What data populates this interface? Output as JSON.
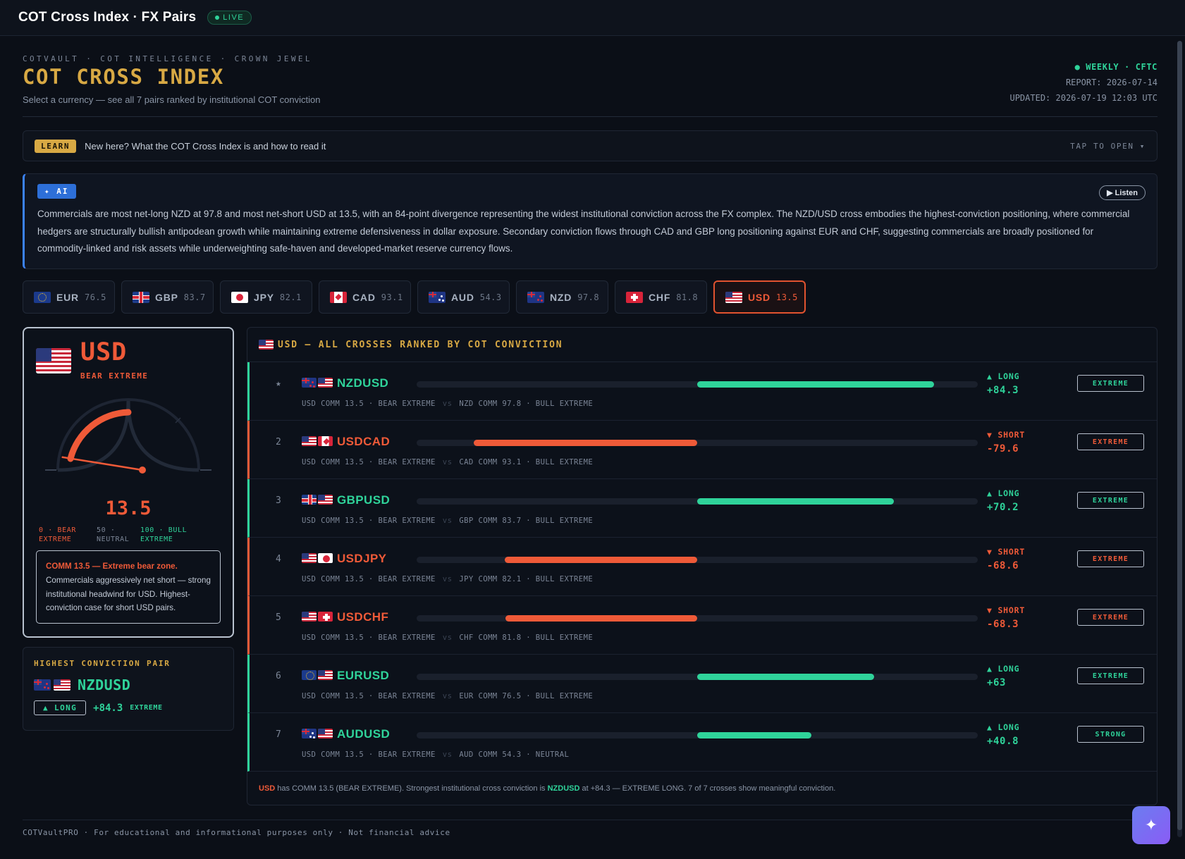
{
  "topbar": {
    "title": "COT Cross Index · FX Pairs",
    "live_label": "LIVE"
  },
  "header": {
    "eyebrow": "COTVAULT · COT INTELLIGENCE · CROWN JEWEL",
    "title": "COT CROSS INDEX",
    "subtitle": "Select a currency — see all 7 pairs ranked by institutional COT conviction",
    "weekly": "● WEEKLY · CFTC",
    "report": "REPORT: 2026-07-14",
    "updated": "UPDATED: 2026-07-19 12:03 UTC"
  },
  "learn": {
    "badge": "LEARN",
    "text": "New here? What the COT Cross Index is and how to read it",
    "tap": "TAP TO OPEN ▾"
  },
  "ai": {
    "badge": "✦ AI",
    "listen": "▶ Listen",
    "text": "Commercials are most net-long NZD at 97.8 and most net-short USD at 13.5, with an 84-point divergence representing the widest institutional conviction across the FX complex. The NZD/USD cross embodies the highest-conviction positioning, where commercial hedgers are structurally bullish antipodean growth while maintaining extreme defensiveness in dollar exposure. Secondary conviction flows through CAD and GBP long positioning against EUR and CHF, suggesting commercials are broadly positioned for commodity-linked and risk assets while underweighting safe-haven and developed-market reserve currency flows."
  },
  "tabs": [
    {
      "code": "EUR",
      "score": "76.5",
      "flag": "f-eur"
    },
    {
      "code": "GBP",
      "score": "83.7",
      "flag": "f-gbp"
    },
    {
      "code": "JPY",
      "score": "82.1",
      "flag": "f-jpy"
    },
    {
      "code": "CAD",
      "score": "93.1",
      "flag": "f-cad"
    },
    {
      "code": "AUD",
      "score": "54.3",
      "flag": "f-aud"
    },
    {
      "code": "NZD",
      "score": "97.8",
      "flag": "f-nzd"
    },
    {
      "code": "CHF",
      "score": "81.8",
      "flag": "f-chf"
    },
    {
      "code": "USD",
      "score": "13.5",
      "flag": "f-usd",
      "active": true
    }
  ],
  "gauge": {
    "currency": "USD",
    "zone": "BEAR EXTREME",
    "value": "13.5",
    "value_num": 13.5,
    "scale_bear": "0 · BEAR EXTREME",
    "scale_bear_a": "0 · BEAR",
    "scale_bear_b": "EXTREME",
    "scale_neutral_a": "50 ·",
    "scale_neutral_b": "NEUTRAL",
    "scale_bull_a": "100 · BULL",
    "scale_bull_b": "EXTREME",
    "note_bold": "COMM 13.5 — Extreme bear zone.",
    "note_rest": " Commercials aggressively net short — strong institutional headwind for USD. Highest-conviction case for short USD pairs."
  },
  "highest": {
    "label": "HIGHEST CONVICTION PAIR",
    "pair": "NZDUSD",
    "direction": "▲ LONG",
    "change": "+84.3",
    "strength": "EXTREME"
  },
  "ranking": {
    "title": "USD — ALL CROSSES RANKED BY COT CONVICTION",
    "rows": [
      {
        "rank": "★",
        "pair": "NZDUSD",
        "flags": [
          "f-nzd",
          "f-usd"
        ],
        "dir": "▲ LONG",
        "change": "+84.3",
        "value": 84.3,
        "tag": "EXTREME",
        "left": "USD COMM 13.5 · BEAR EXTREME",
        "vs": "vs",
        "right": "NZD COMM 97.8 · BULL EXTREME"
      },
      {
        "rank": "2",
        "pair": "USDCAD",
        "flags": [
          "f-usd",
          "f-cad"
        ],
        "dir": "▼ SHORT",
        "change": "-79.6",
        "value": -79.6,
        "tag": "EXTREME",
        "left": "USD COMM 13.5 · BEAR EXTREME",
        "vs": "vs",
        "right": "CAD COMM 93.1 · BULL EXTREME"
      },
      {
        "rank": "3",
        "pair": "GBPUSD",
        "flags": [
          "f-gbp",
          "f-usd"
        ],
        "dir": "▲ LONG",
        "change": "+70.2",
        "value": 70.2,
        "tag": "EXTREME",
        "left": "USD COMM 13.5 · BEAR EXTREME",
        "vs": "vs",
        "right": "GBP COMM 83.7 · BULL EXTREME"
      },
      {
        "rank": "4",
        "pair": "USDJPY",
        "flags": [
          "f-usd",
          "f-jpy"
        ],
        "dir": "▼ SHORT",
        "change": "-68.6",
        "value": -68.6,
        "tag": "EXTREME",
        "left": "USD COMM 13.5 · BEAR EXTREME",
        "vs": "vs",
        "right": "JPY COMM 82.1 · BULL EXTREME"
      },
      {
        "rank": "5",
        "pair": "USDCHF",
        "flags": [
          "f-usd",
          "f-chf"
        ],
        "dir": "▼ SHORT",
        "change": "-68.3",
        "value": -68.3,
        "tag": "EXTREME",
        "left": "USD COMM 13.5 · BEAR EXTREME",
        "vs": "vs",
        "right": "CHF COMM 81.8 · BULL EXTREME"
      },
      {
        "rank": "6",
        "pair": "EURUSD",
        "flags": [
          "f-eur",
          "f-usd"
        ],
        "dir": "▲ LONG",
        "change": "+63",
        "value": 63,
        "tag": "EXTREME",
        "left": "USD COMM 13.5 · BEAR EXTREME",
        "vs": "vs",
        "right": "EUR COMM 76.5 · BULL EXTREME"
      },
      {
        "rank": "7",
        "pair": "AUDUSD",
        "flags": [
          "f-aud",
          "f-usd"
        ],
        "dir": "▲ LONG",
        "change": "+40.8",
        "value": 40.8,
        "tag": "STRONG",
        "left": "USD COMM 13.5 · BEAR EXTREME",
        "vs": "vs",
        "right": "AUD COMM 54.3 · NEUTRAL"
      }
    ],
    "footer": {
      "cur": "USD",
      "t1": " has COMM 13.5 (BEAR EXTREME). Strongest institutional cross conviction is ",
      "pair": "NZDUSD",
      "t2": " at +84.3 — EXTREME LONG. 7 of 7 crosses show meaningful conviction."
    }
  },
  "footer": "COTVaultPRO · For educational and informational purposes only · Not financial advice",
  "fab_icon": "✦",
  "colors": {
    "bull": "#2fd39a",
    "bear": "#ef5a38",
    "gold": "#d8a944",
    "ai": "#3b82f6"
  }
}
